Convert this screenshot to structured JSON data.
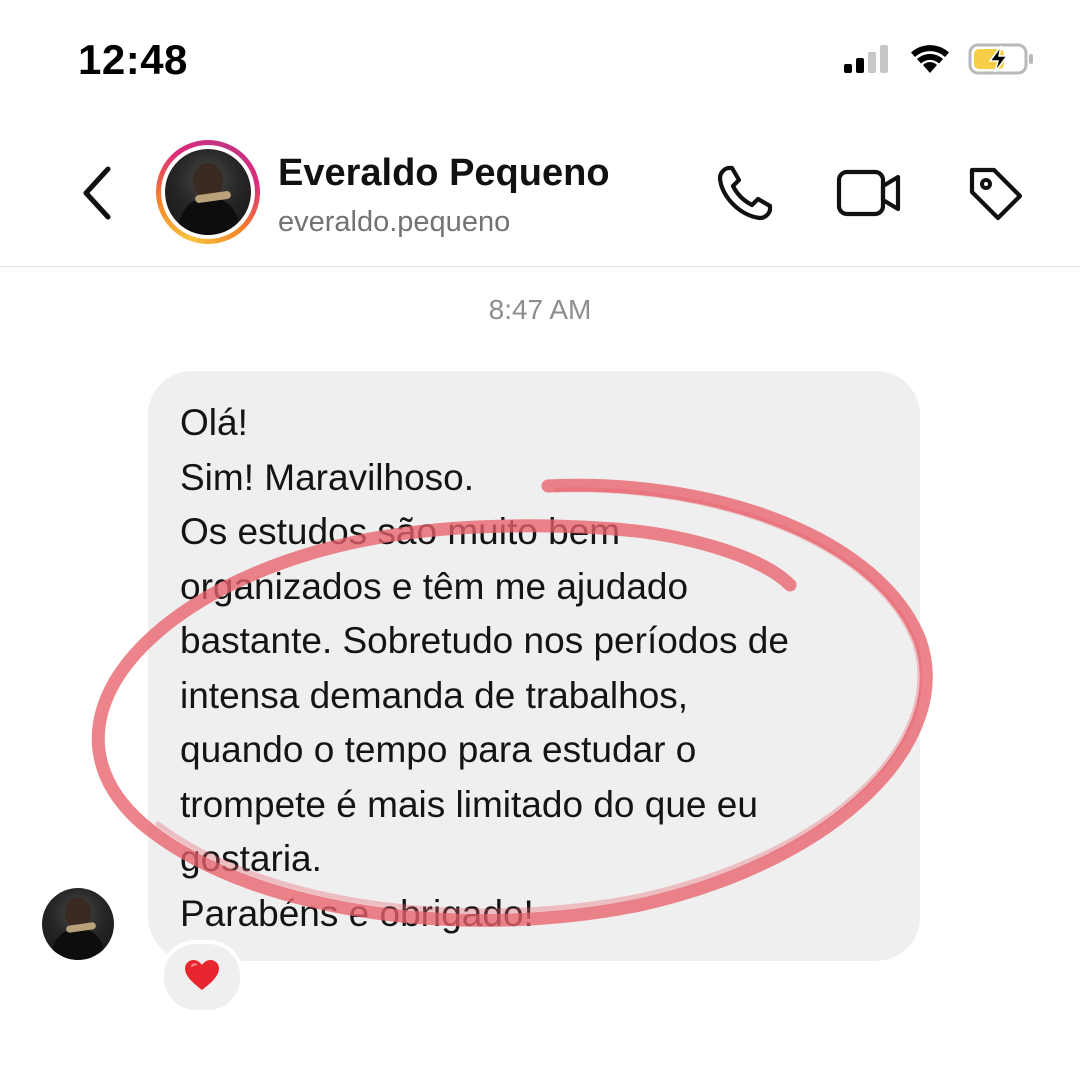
{
  "status_bar": {
    "time": "12:48",
    "icons": [
      "cellular-signal-icon",
      "wifi-icon",
      "battery-charging-icon"
    ]
  },
  "header": {
    "back_icon": "chevron-left-icon",
    "contact_name": "Everaldo Pequeno",
    "contact_handle": "everaldo.pequeno",
    "actions": [
      "phone-icon",
      "video-camera-icon",
      "tag-icon"
    ],
    "story_ring_colors": [
      "#f9c23c",
      "#f58529",
      "#dd2a7b",
      "#c13584"
    ]
  },
  "conversation": {
    "timestamp": "8:47 AM",
    "message": {
      "lines": [
        "Olá!",
        "Sim! Maravilhoso.",
        "Os estudos são muito bem",
        "organizados e têm me ajudado",
        "bastante. Sobretudo nos períodos de",
        "intensa demanda de trabalhos,",
        "quando o tempo para estudar o",
        "trompete é mais limitado do que eu",
        "gostaria.",
        "Parabéns e obrigado!"
      ],
      "reaction": "❤️"
    },
    "annotation_color": "#e8616b"
  },
  "colors": {
    "bubble": "#efeff0",
    "secondary_text": "#8e8e8e",
    "battery": "#f7cf46"
  }
}
